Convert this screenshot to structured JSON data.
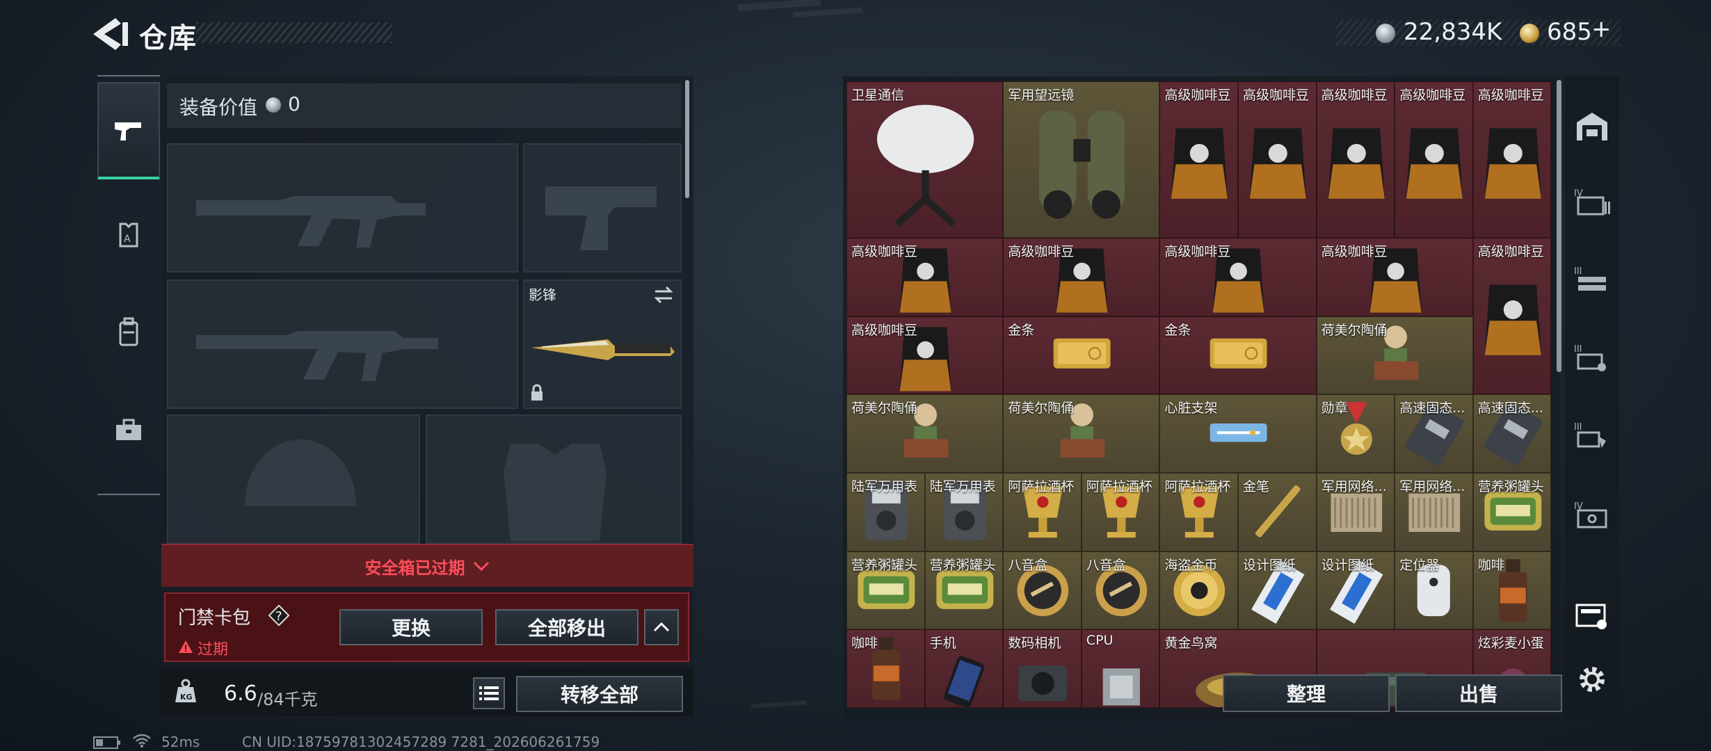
{
  "header": {
    "title": "仓库",
    "currency": "22,834K",
    "premium": "685",
    "premium_plus": "+"
  },
  "left_rail": {
    "tabs": [
      "weapon-tab",
      "armor-tab",
      "backpack-tab",
      "toolbox-tab"
    ]
  },
  "loadout": {
    "value_label": "装备价值",
    "value": "0",
    "melee_name": "影锋"
  },
  "safe_box": {
    "expired_text": "安全箱已过期",
    "card_title": "门禁卡包",
    "card_status": "过期",
    "replace_label": "更换",
    "remove_all_label": "全部移出"
  },
  "capacity": {
    "current": "6.6",
    "max": "/84千克",
    "transfer_label": "转移全部"
  },
  "stash": {
    "items": [
      {
        "name": "卫星通信",
        "tone": "red",
        "icon": "satellite-dish"
      },
      {
        "name": "军用望远镜",
        "tone": "gold",
        "icon": "binoculars"
      },
      {
        "name": "高级咖啡豆",
        "tone": "red",
        "icon": "coffee-bag"
      },
      {
        "name": "高级咖啡豆",
        "tone": "red",
        "icon": "coffee-bag"
      },
      {
        "name": "高级咖啡豆",
        "tone": "red",
        "icon": "coffee-bag"
      },
      {
        "name": "高级咖啡豆",
        "tone": "red",
        "icon": "coffee-bag"
      },
      {
        "name": "高级咖啡豆",
        "tone": "red",
        "icon": "coffee-bag"
      },
      {
        "name": "高级咖啡豆",
        "tone": "red",
        "icon": "coffee-bag"
      },
      {
        "name": "高级咖啡豆",
        "tone": "red",
        "icon": "coffee-bag"
      },
      {
        "name": "高级咖啡豆",
        "tone": "red",
        "icon": "coffee-bag"
      },
      {
        "name": "高级咖啡豆",
        "tone": "red",
        "icon": "coffee-bag"
      },
      {
        "name": "高级咖啡豆",
        "tone": "red",
        "icon": "coffee-bag"
      },
      {
        "name": "高级咖啡豆",
        "tone": "red",
        "icon": "coffee-bag"
      },
      {
        "name": "金条",
        "tone": "red",
        "icon": "gold-bar"
      },
      {
        "name": "金条",
        "tone": "red",
        "icon": "gold-bar"
      },
      {
        "name": "荷美尔陶俑",
        "tone": "gold",
        "icon": "figurine"
      },
      {
        "name": "荷美尔陶俑",
        "tone": "gold",
        "icon": "figurine"
      },
      {
        "name": "荷美尔陶俑",
        "tone": "gold",
        "icon": "figurine"
      },
      {
        "name": "心脏支架",
        "tone": "gold",
        "icon": "stent"
      },
      {
        "name": "勋章",
        "tone": "gold",
        "icon": "medal"
      },
      {
        "name": "高速固态...",
        "tone": "gold",
        "icon": "ssd"
      },
      {
        "name": "高速固态...",
        "tone": "gold",
        "icon": "ssd"
      },
      {
        "name": "陆军万用表",
        "tone": "gold",
        "icon": "multimeter"
      },
      {
        "name": "陆军万用表",
        "tone": "gold",
        "icon": "multimeter"
      },
      {
        "name": "阿萨拉酒杯",
        "tone": "gold",
        "icon": "goblet"
      },
      {
        "name": "阿萨拉酒杯",
        "tone": "gold",
        "icon": "goblet"
      },
      {
        "name": "阿萨拉酒杯",
        "tone": "gold",
        "icon": "goblet"
      },
      {
        "name": "金笔",
        "tone": "gold",
        "icon": "pen"
      },
      {
        "name": "军用网络...",
        "tone": "gold",
        "icon": "network-box"
      },
      {
        "name": "军用网络...",
        "tone": "gold",
        "icon": "network-box"
      },
      {
        "name": "营养粥罐头",
        "tone": "gold",
        "icon": "tin"
      },
      {
        "name": "营养粥罐头",
        "tone": "gold",
        "icon": "tin"
      },
      {
        "name": "营养粥罐头",
        "tone": "gold",
        "icon": "tin"
      },
      {
        "name": "八音盒",
        "tone": "gold",
        "icon": "music-box"
      },
      {
        "name": "八音盒",
        "tone": "gold",
        "icon": "music-box"
      },
      {
        "name": "海盗金币",
        "tone": "gold",
        "icon": "coin"
      },
      {
        "name": "设计图纸",
        "tone": "gold",
        "icon": "blueprint"
      },
      {
        "name": "设计图纸",
        "tone": "gold",
        "icon": "blueprint"
      },
      {
        "name": "定位器",
        "tone": "gold",
        "icon": "tracker"
      },
      {
        "name": "咖啡",
        "tone": "gold",
        "icon": "bottle"
      },
      {
        "name": "咖啡",
        "tone": "red",
        "icon": "bottle"
      },
      {
        "name": "手机",
        "tone": "red",
        "icon": "phone"
      },
      {
        "name": "数码相机",
        "tone": "red",
        "icon": "camera"
      },
      {
        "name": "CPU",
        "tone": "red",
        "icon": "cpu"
      },
      {
        "name": "黄金鸟窝",
        "tone": "red",
        "icon": "nest"
      },
      {
        "name": "",
        "tone": "red",
        "icon": "case"
      },
      {
        "name": "炫彩麦小蛋",
        "tone": "red",
        "icon": "egg"
      }
    ],
    "organize_label": "整理",
    "sell_label": "出售"
  },
  "status_bar": {
    "ping": "52ms",
    "uid": "CN UID:18759781302457289 7281_202606261759"
  },
  "colors": {
    "accent": "#3ad2a2",
    "danger": "#ff4d5a",
    "rare_red": "#5c2a32",
    "rare_gold": "#5e5638"
  }
}
